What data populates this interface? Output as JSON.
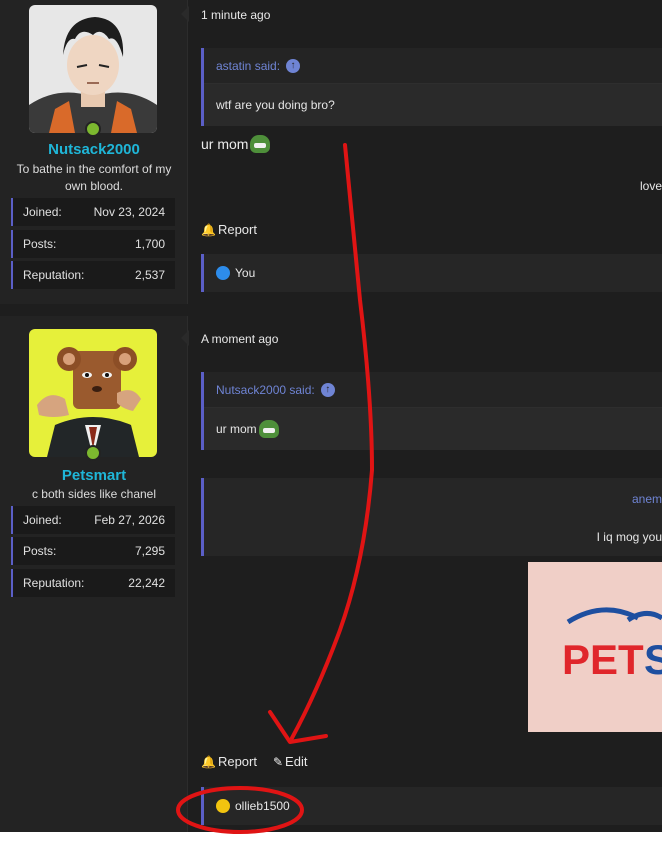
{
  "post1": {
    "date": "1 minute ago",
    "user": {
      "name": "Nutsack2000",
      "title": "To bathe in the comfort of my own blood."
    },
    "stats": [
      {
        "label": "Joined:",
        "value": "Nov 23, 2024"
      },
      {
        "label": "Posts:",
        "value": "1,700"
      },
      {
        "label": "Reputation:",
        "value": "2,537"
      }
    ],
    "quote": {
      "author": "astatin said:",
      "text": "wtf are you doing bro?"
    },
    "message": "ur mom",
    "right_text": "love",
    "report_label": "Report",
    "reaction_user": "You"
  },
  "post2": {
    "date": "A moment ago",
    "user": {
      "name": "Petsmart",
      "title": "c both sides like chanel"
    },
    "stats": [
      {
        "label": "Joined:",
        "value": "Feb 27, 2026"
      },
      {
        "label": "Posts:",
        "value": "7,295"
      },
      {
        "label": "Reputation:",
        "value": "22,242"
      }
    ],
    "quote": {
      "author": "Nutsack2000 said:",
      "text": "ur mom"
    },
    "nested_quote": {
      "author": "anem",
      "text": "I iq mog you"
    },
    "image_text": "PET",
    "report_label": "Report",
    "edit_label": "Edit",
    "reaction_user": "ollieb1500"
  },
  "colors": {
    "accent": "#5b5fc7",
    "username": "#1fb6d8",
    "link": "#6f84d4",
    "online": "#7cb82f",
    "annotation": "#e01414"
  },
  "icons": {
    "report": "bell-icon",
    "edit": "pencil-icon",
    "quote_jump": "arrow-up-circle-icon",
    "like": "thumbs-up-icon",
    "laugh": "laughing-emoji-icon"
  }
}
